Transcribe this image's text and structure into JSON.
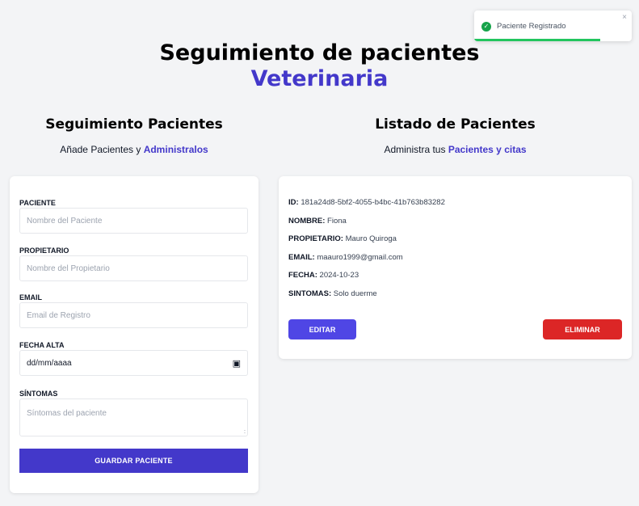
{
  "header": {
    "title_line1": "Seguimiento de pacientes",
    "title_line2": "Veterinaria"
  },
  "form_section": {
    "title": "Seguimiento Pacientes",
    "subtitle_prefix": "Añade Pacientes y ",
    "subtitle_accent": "Administralos"
  },
  "list_section": {
    "title": "Listado de Pacientes",
    "subtitle_prefix": "Administra tus ",
    "subtitle_accent": "Pacientes y citas"
  },
  "form": {
    "paciente_label": "PACIENTE",
    "paciente_placeholder": "Nombre del Paciente",
    "propietario_label": "PROPIETARIO",
    "propietario_placeholder": "Nombre del Propietario",
    "email_label": "EMAIL",
    "email_placeholder": "Email de Registro",
    "fecha_label": "FECHA ALTA",
    "fecha_value": "dd/mm/aaaa",
    "sintomas_label": "SÍNTOMAS",
    "sintomas_placeholder": "Síntomas del paciente",
    "submit_label": "GUARDAR PACIENTE"
  },
  "patient": {
    "id_label": "ID:",
    "id_value": "181a24d8-5bf2-4055-b4bc-41b763b83282",
    "nombre_label": "NOMBRE:",
    "nombre_value": "Fiona",
    "propietario_label": "PROPIETARIO:",
    "propietario_value": "Mauro Quiroga",
    "email_label": "EMAIL:",
    "email_value": "maauro1999@gmail.com",
    "fecha_label": "FECHA:",
    "fecha_value": "2024-10-23",
    "sintomas_label": "SINTOMAS:",
    "sintomas_value": "Solo duerme",
    "edit_label": "EDITAR",
    "delete_label": "ELIMINAR"
  },
  "toast": {
    "message": "Paciente Registrado",
    "close_symbol": "×",
    "progress": 0.8
  },
  "colors": {
    "accent": "#4338ca",
    "edit": "#4f46e5",
    "delete": "#dc2626",
    "success": "#22c55e"
  }
}
